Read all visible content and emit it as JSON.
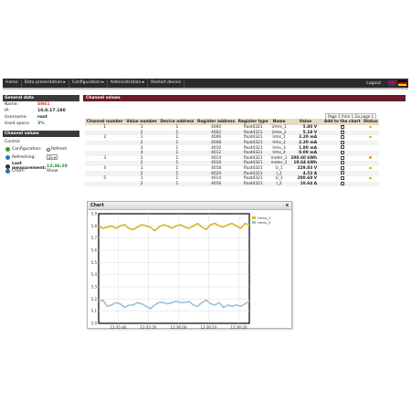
{
  "nav": {
    "items": [
      "Home",
      "Data presentation ▸",
      "Configuration ▸",
      "Administration ▸",
      "Restart device"
    ],
    "logout": "Logout"
  },
  "general": {
    "title": "General data",
    "rows": [
      {
        "k": "Name:",
        "v": "SN61"
      },
      {
        "k": "IP:",
        "v": "10.0.17.180"
      },
      {
        "k": "Username:",
        "v": "root"
      },
      {
        "k": "Used space:",
        "v": "3%"
      }
    ]
  },
  "channel_side": {
    "title": "Channel values",
    "control": "Control",
    "configuration_label": "Configuration:",
    "configuration_value": "Refresh",
    "refreshing_label": "Refreshing:",
    "refreshing_value": "2s",
    "last_label": "Last measurement:",
    "last_value": "12:36:20",
    "chart_label": "Chart:",
    "chart_value": "Show"
  },
  "main": {
    "title": "Channel values",
    "page_label": "Page 1 from 1 Go page 1"
  },
  "table": {
    "headers": [
      "Channel number",
      "Value number",
      "Device address",
      "Register address",
      "Register type",
      "Name",
      "Value",
      "Add to the chart",
      "Status"
    ],
    "rows": [
      {
        "ch": "1",
        "vn": "1",
        "da": "1",
        "ra": "4000",
        "rt": "float4321",
        "name": "Urms_1",
        "value": "5.80 V",
        "chart": true,
        "status": true
      },
      {
        "ch": "",
        "vn": "2",
        "da": "1",
        "ra": "4002",
        "rt": "float4321",
        "name": "Urms_2",
        "value": "5.18 V",
        "chart": true,
        "status": false
      },
      {
        "ch": "2",
        "vn": "1",
        "da": "1",
        "ra": "4006",
        "rt": "float4321",
        "name": "Irms_1",
        "value": "2.20 mA",
        "chart": false,
        "status": true
      },
      {
        "ch": "",
        "vn": "2",
        "da": "1",
        "ra": "4008",
        "rt": "float4321",
        "name": "Irms_2",
        "value": "2.20 mA",
        "chart": false,
        "status": false
      },
      {
        "ch": "",
        "vn": "3",
        "da": "1",
        "ra": "4010",
        "rt": "float4321",
        "name": "Irms_3",
        "value": "1.80 mA",
        "chart": false,
        "status": false
      },
      {
        "ch": "",
        "vn": "4",
        "da": "1",
        "ra": "4012",
        "rt": "float4321",
        "name": "Irms_4",
        "value": "0.00 mA",
        "chart": false,
        "status": false
      },
      {
        "ch": "3",
        "vn": "1",
        "da": "1",
        "ra": "4014",
        "rt": "float4321",
        "name": "meter_1",
        "value": "200.60 kWh",
        "chart": false,
        "status": true
      },
      {
        "ch": "",
        "vn": "2",
        "da": "1",
        "ra": "4016",
        "rt": "float4321",
        "name": "meter_2",
        "value": "10.64 kWh",
        "chart": false,
        "status": false
      },
      {
        "ch": "4",
        "vn": "1",
        "da": "1",
        "ra": "4018",
        "rt": "float4321",
        "name": "U_1",
        "value": "229.83 V",
        "chart": false,
        "status": true
      },
      {
        "ch": "",
        "vn": "2",
        "da": "1",
        "ra": "4020",
        "rt": "float4321",
        "name": "I_2",
        "value": "4.53 A",
        "chart": false,
        "status": false
      },
      {
        "ch": "5",
        "vn": "1",
        "da": "1",
        "ra": "4014",
        "rt": "float4321",
        "name": "U_1",
        "value": "200.60 V",
        "chart": false,
        "status": true
      },
      {
        "ch": "",
        "vn": "2",
        "da": "1",
        "ra": "4016",
        "rt": "float4321",
        "name": "I_2",
        "value": "10.64 A",
        "chart": false,
        "status": false
      }
    ]
  },
  "chart_window": {
    "title": "Chart",
    "close": "x"
  },
  "chart_data": {
    "type": "line",
    "ylim": [
      5.0,
      5.9
    ],
    "yticks": [
      "5.9",
      "5.8",
      "5.7",
      "5.6",
      "5.5",
      "5.4",
      "5.3",
      "5.2",
      "5.1",
      "5.0"
    ],
    "xticks": [
      "12:35:40",
      "12:35:50",
      "12:36:00",
      "12:36:10",
      "12:36:20"
    ],
    "series": [
      {
        "name": "Urms_1",
        "color": "#d9b62a",
        "values": [
          5.8,
          5.78,
          5.79,
          5.8,
          5.78,
          5.8,
          5.81,
          5.78,
          5.77,
          5.79,
          5.81,
          5.8,
          5.79,
          5.76,
          5.79,
          5.81,
          5.8,
          5.78,
          5.8,
          5.81,
          5.79,
          5.78,
          5.8,
          5.82,
          5.79,
          5.77,
          5.81,
          5.82,
          5.8,
          5.79,
          5.81,
          5.82,
          5.8,
          5.78,
          5.82,
          5.81
        ]
      },
      {
        "name": "Urms_2",
        "color": "#9cc2d8",
        "values": [
          5.18,
          5.19,
          5.14,
          5.15,
          5.17,
          5.16,
          5.13,
          5.15,
          5.15,
          5.17,
          5.16,
          5.14,
          5.12,
          5.15,
          5.17,
          5.17,
          5.16,
          5.17,
          5.18,
          5.17,
          5.17,
          5.18,
          5.15,
          5.14,
          5.17,
          5.19,
          5.16,
          5.15,
          5.17,
          5.13,
          5.15,
          5.14,
          5.15,
          5.14,
          5.16,
          5.18
        ]
      }
    ]
  },
  "colors": {
    "accent": "#6b1a2a",
    "nav": "#2b2b2b",
    "status_dot": "#e0a300"
  }
}
